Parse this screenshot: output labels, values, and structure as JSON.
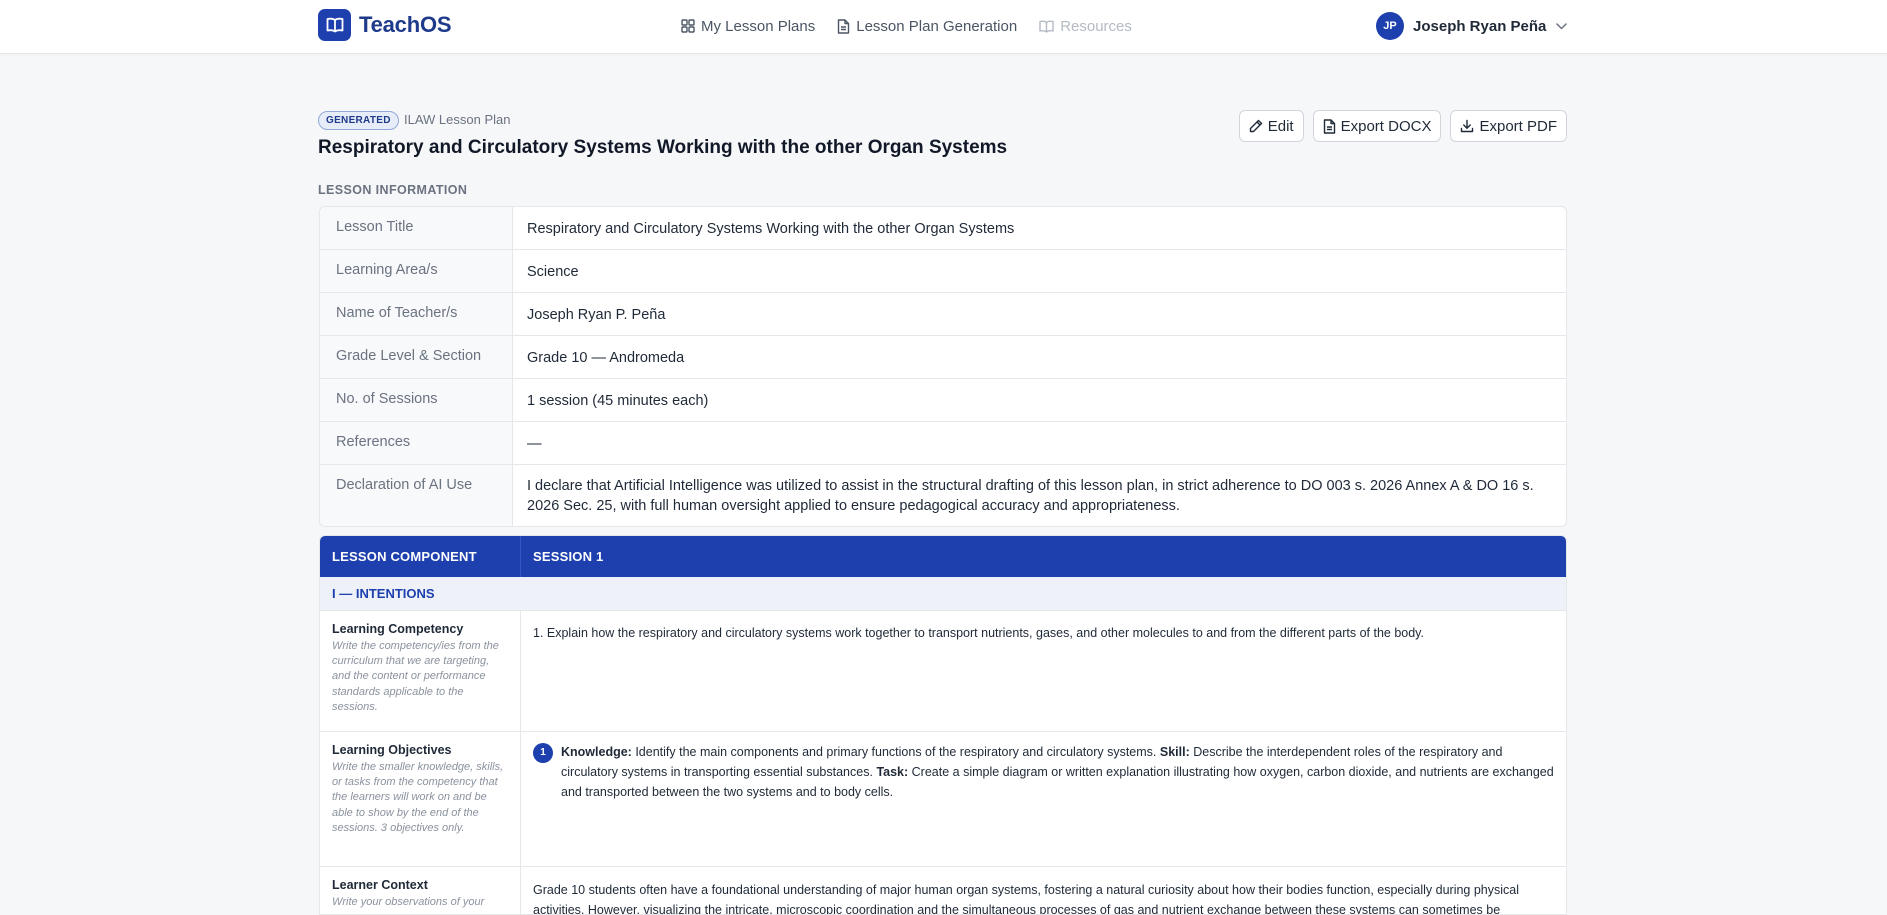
{
  "brand": {
    "name": "TeachOS"
  },
  "nav": {
    "items": [
      {
        "label": "My Lesson Plans",
        "icon": "grid-icon"
      },
      {
        "label": "Lesson Plan Generation",
        "icon": "document-icon"
      },
      {
        "label": "Resources",
        "icon": "book-icon"
      }
    ]
  },
  "user": {
    "initials": "JP",
    "name": "Joseph Ryan Peña"
  },
  "header": {
    "badge": "GENERATED",
    "plan_type": "ILAW Lesson Plan",
    "title": "Respiratory and Circulatory Systems Working with the other Organ Systems"
  },
  "actions": {
    "edit": "Edit",
    "export_docx": "Export DOCX",
    "export_pdf": "Export PDF"
  },
  "lesson_info": {
    "label": "LESSON INFORMATION",
    "rows": [
      {
        "key": "Lesson Title",
        "value": "Respiratory and Circulatory Systems Working with the other Organ Systems"
      },
      {
        "key": "Learning Area/s",
        "value": "Science"
      },
      {
        "key": "Name of Teacher/s",
        "value": "Joseph Ryan P. Peña"
      },
      {
        "key": "Grade Level & Section",
        "value": "Grade 10 — Andromeda"
      },
      {
        "key": "No. of Sessions",
        "value": "1 session (45 minutes each)"
      },
      {
        "key": "References",
        "value": "—"
      },
      {
        "key": "Declaration of AI Use",
        "value": "I declare that Artificial Intelligence was utilized to assist in the structural drafting of this lesson plan, in strict adherence to DO 003 s. 2026 Annex A & DO 16 s. 2026 Sec. 25, with full human oversight applied to ensure pedagogical accuracy and appropriateness."
      }
    ]
  },
  "components": {
    "col1": "LESSON COMPONENT",
    "col2": "SESSION 1",
    "section": "I — INTENTIONS",
    "competency": {
      "title": "Learning Competency",
      "hint": "Write the competency/ies from the curriculum that we are targeting, and the content or performance standards applicable to the sessions.",
      "value": "1. Explain how the respiratory and circulatory systems work together to transport nutrients, gases, and other molecules to and from the different parts of the body."
    },
    "objectives": {
      "title": "Learning Objectives",
      "hint": "Write the smaller knowledge, skills, or tasks from the competency that the learners will work on and be able to show by the end of the sessions. 3 objectives only.",
      "number": "1",
      "knowledge_label": "Knowledge:",
      "knowledge": "Identify the main components and primary functions of the respiratory and circulatory systems.",
      "skill_label": "Skill:",
      "skill": "Describe the interdependent roles of the respiratory and circulatory systems in transporting essential substances.",
      "task_label": "Task:",
      "task": "Create a simple diagram or written explanation illustrating how oxygen, carbon dioxide, and nutrients are exchanged and transported between the two systems and to body cells."
    },
    "learner_context": {
      "title": "Learner Context",
      "hint": "Write your observations of your",
      "value": "Grade 10 students often have a foundational understanding of major human organ systems, fostering a natural curiosity about how their bodies function, especially during physical activities. However, visualizing the intricate, microscopic coordination and the simultaneous processes of gas and nutrient exchange between these systems can sometimes be"
    }
  },
  "colors": {
    "primary": "#1e40af",
    "brand_text": "#1e3a8a",
    "muted": "#6b7280"
  }
}
